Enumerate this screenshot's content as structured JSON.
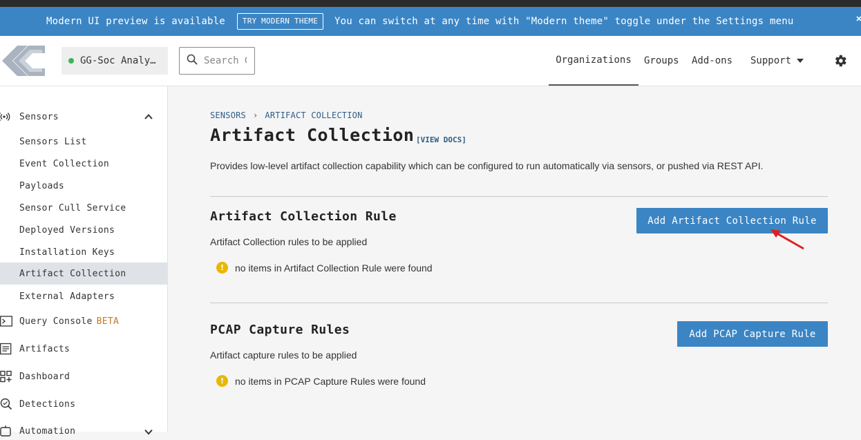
{
  "banner": {
    "message": "Modern UI preview is available",
    "try_button": "TRY MODERN THEME",
    "hint": "You can switch at any time with \"Modern theme\" toggle under the Settings menu"
  },
  "header": {
    "org_name": "GG-Soc Analy…",
    "org_status_color": "#3cb45a",
    "search_placeholder": "Search G",
    "nav": {
      "organizations": "Organizations",
      "groups": "Groups",
      "addons": "Add-ons",
      "support": "Support"
    }
  },
  "sidebar": {
    "sensors_label": "Sensors",
    "sensors_items": [
      {
        "label": "Sensors List"
      },
      {
        "label": "Event Collection"
      },
      {
        "label": "Payloads"
      },
      {
        "label": "Sensor Cull Service"
      },
      {
        "label": "Deployed Versions"
      },
      {
        "label": "Installation Keys"
      },
      {
        "label": "Artifact Collection",
        "active": true
      },
      {
        "label": "External Adapters"
      }
    ],
    "query_console": "Query Console",
    "beta": "BETA",
    "artifacts": "Artifacts",
    "dashboard": "Dashboard",
    "detections": "Detections",
    "automation": "Automation"
  },
  "main": {
    "breadcrumb": {
      "parent": "SENSORS",
      "sep": "›",
      "current": "ARTIFACT COLLECTION"
    },
    "title": "Artifact Collection",
    "docs_link": "[VIEW DOCS]",
    "description": "Provides low-level artifact collection capability which can be configured to run automatically via sensors, or pushed via REST API.",
    "sections": [
      {
        "title": "Artifact Collection Rule",
        "subtitle": "Artifact Collection rules to be applied",
        "empty": "no items in Artifact Collection Rule were found",
        "button": "Add Artifact Collection Rule"
      },
      {
        "title": "PCAP Capture Rules",
        "subtitle": "Artifact capture rules to be applied",
        "empty": "no items in PCAP Capture Rules were found",
        "button": "Add PCAP Capture Rule"
      }
    ]
  },
  "colors": {
    "accent": "#3b85c4",
    "warning": "#e8b800",
    "annotation_arrow": "#e02020"
  }
}
